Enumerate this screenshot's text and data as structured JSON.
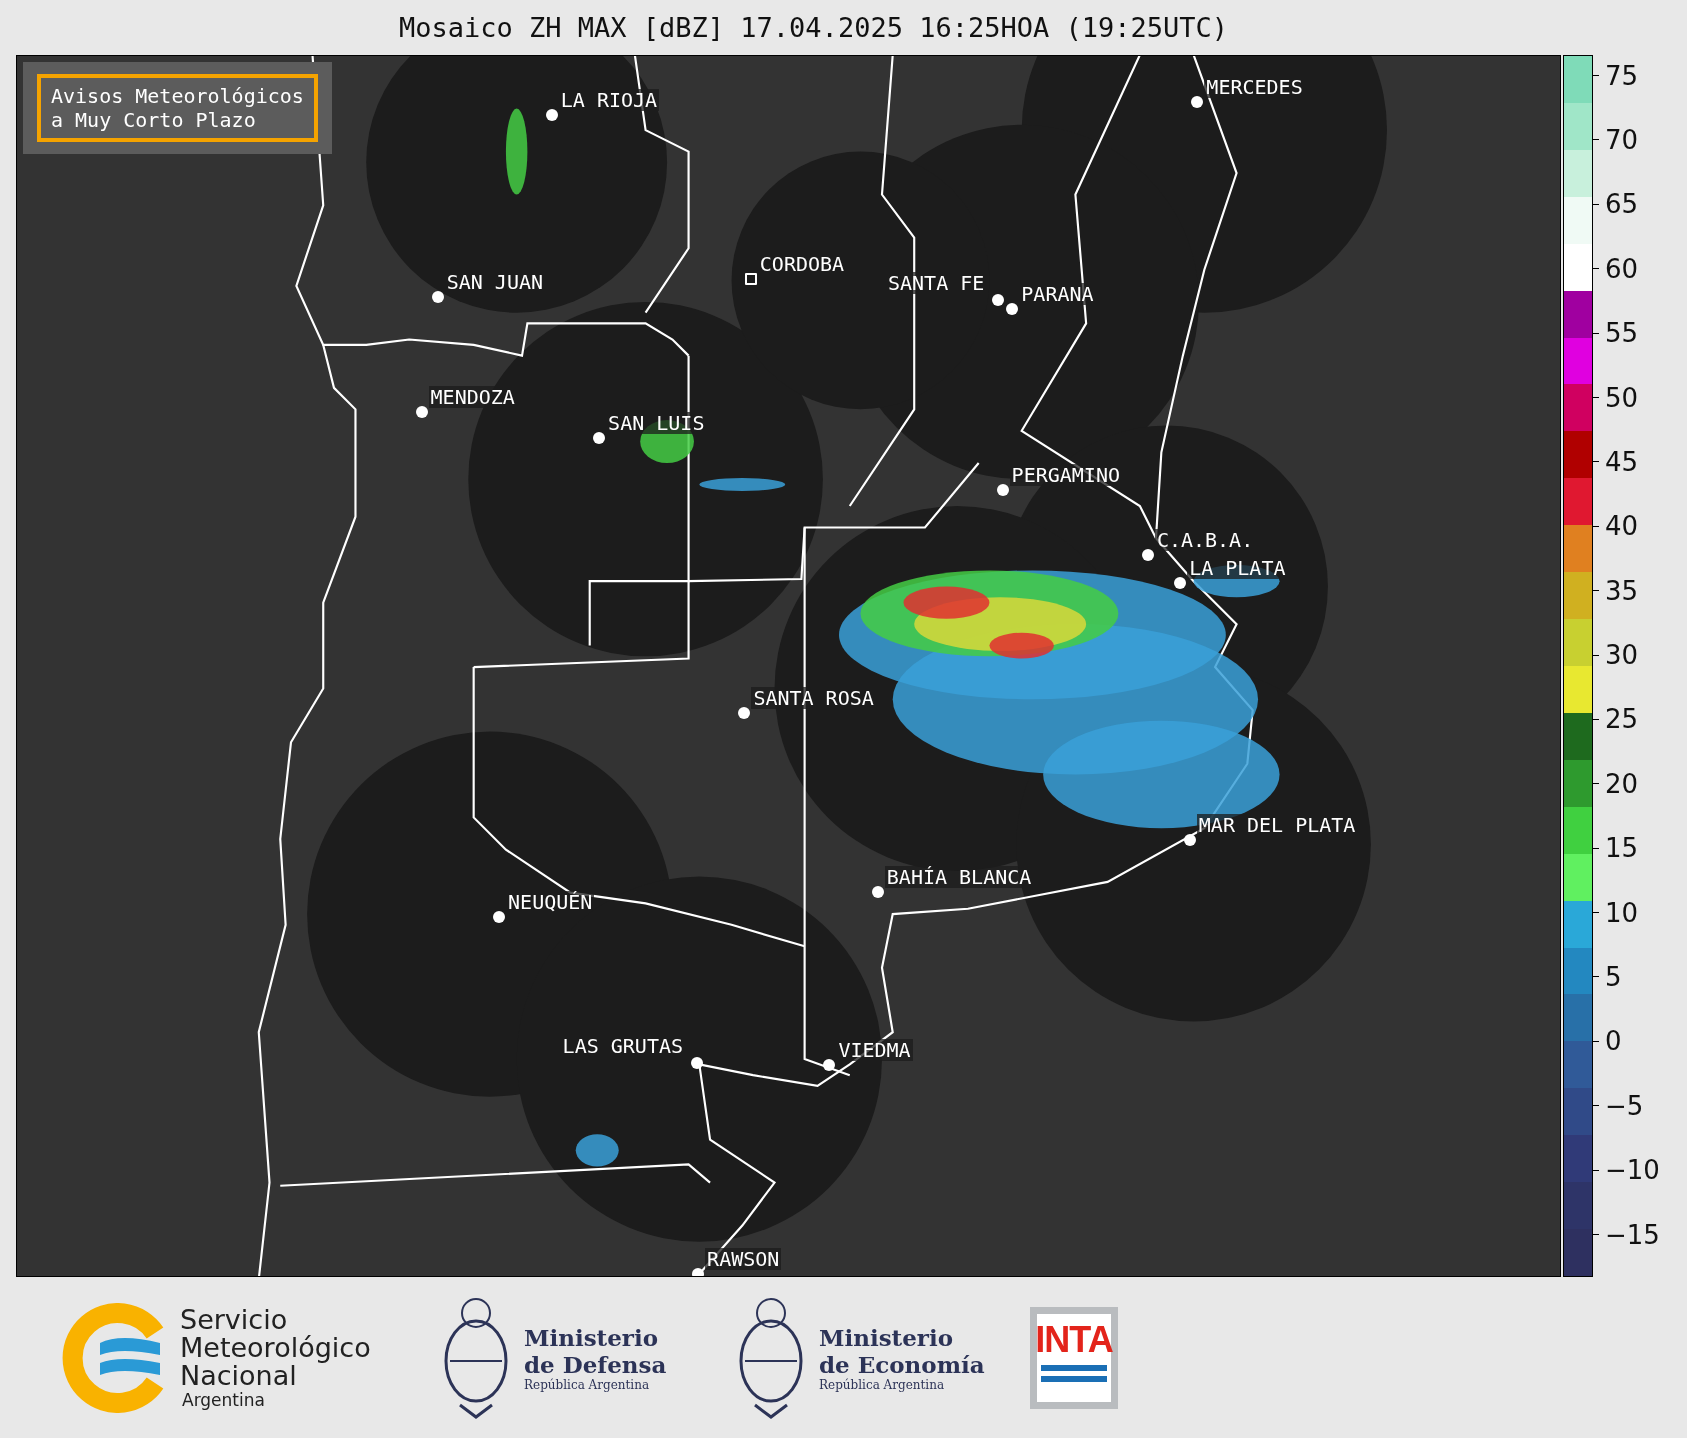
{
  "title": "Mosaico ZH MAX [dBZ] 17.04.2025 16:25HOA (19:25UTC)",
  "legend": {
    "lines": [
      "Avisos Meteorológicos",
      "a Muy Corto Plazo"
    ]
  },
  "cities": [
    {
      "name": "LA RIOJA",
      "kind": "dot"
    },
    {
      "name": "SAN JUAN",
      "kind": "dot"
    },
    {
      "name": "CORDOBA",
      "kind": "square"
    },
    {
      "name": "SANTA FE",
      "kind": "dot"
    },
    {
      "name": "PARANA",
      "kind": "dot"
    },
    {
      "name": "MERCEDES",
      "kind": "dot"
    },
    {
      "name": "MENDOZA",
      "kind": "dot"
    },
    {
      "name": "SAN LUIS",
      "kind": "dot"
    },
    {
      "name": "PERGAMINO",
      "kind": "dot"
    },
    {
      "name": "C.A.B.A.",
      "kind": "dot"
    },
    {
      "name": "LA PLATA",
      "kind": "dot"
    },
    {
      "name": "SANTA ROSA",
      "kind": "dot"
    },
    {
      "name": "MAR DEL PLATA",
      "kind": "dot"
    },
    {
      "name": "BAHÍA BLANCA",
      "kind": "dot"
    },
    {
      "name": "NEUQUÉN",
      "kind": "dot"
    },
    {
      "name": "LAS GRUTAS",
      "kind": "dot"
    },
    {
      "name": "VIEDMA",
      "kind": "dot"
    },
    {
      "name": "RAWSON",
      "kind": "dot"
    }
  ],
  "colorbar": {
    "ticks": [
      "75",
      "70",
      "65",
      "60",
      "55",
      "50",
      "45",
      "40",
      "35",
      "30",
      "25",
      "20",
      "15",
      "10",
      "5",
      "0",
      "−5",
      "−10",
      "−15"
    ]
  },
  "footer": {
    "smn": {
      "lines": [
        "Servicio",
        "Meteorológico",
        "Nacional"
      ],
      "sub": "Argentina"
    },
    "ministries": [
      {
        "name": "Ministerio",
        "sub": "de Defensa",
        "country": "República Argentina"
      },
      {
        "name": "Ministerio",
        "sub": "de Economía",
        "country": "República Argentina"
      }
    ],
    "inta": "INTA"
  }
}
